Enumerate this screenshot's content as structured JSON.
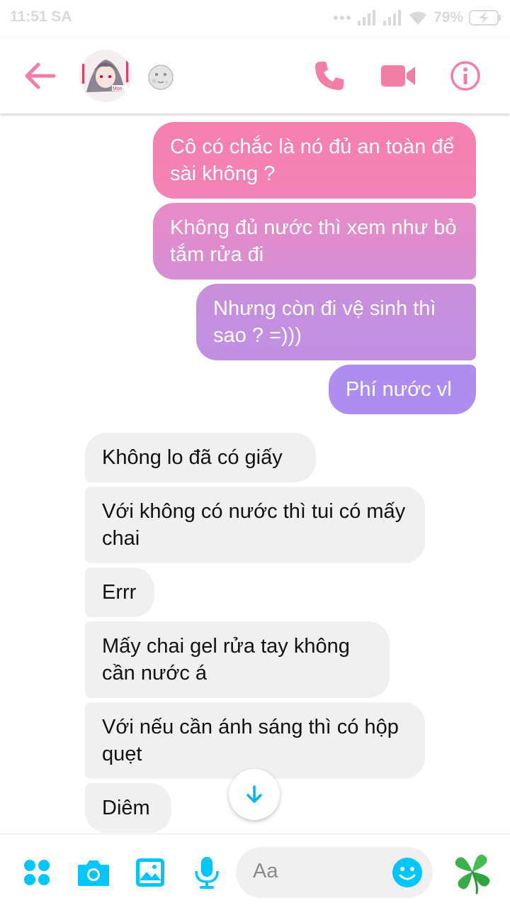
{
  "status_bar": {
    "time": "11:51 SA",
    "battery": "79%"
  },
  "header": {
    "back_icon": "arrow-left-icon",
    "avatar_icon": "avatar",
    "status_icon": "moon-emoji-icon",
    "call_icon": "phone-icon",
    "video_icon": "video-camera-icon",
    "info_icon": "info-icon",
    "accent": "#f27ea6"
  },
  "messages": [
    {
      "from": "me",
      "text": "Cô có chắc là nó đủ an toàn để sài không ?"
    },
    {
      "from": "me",
      "text": "Không đủ nước thì xem như bỏ tắm rửa đi"
    },
    {
      "from": "me",
      "text": "Nhưng còn đi vệ sinh thì sao ? =)))"
    },
    {
      "from": "me",
      "text": "Phí nước vl"
    },
    {
      "from": "them",
      "text": "Không lo đã có giấy"
    },
    {
      "from": "them",
      "text": "Với không có nước thì tui có mấy chai"
    },
    {
      "from": "them",
      "text": "Errr"
    },
    {
      "from": "them",
      "text": "Mấy chai gel rửa tay không cần nước á"
    },
    {
      "from": "them",
      "text": "Với nếu cần ánh sáng thì có hộp quẹt"
    },
    {
      "from": "them",
      "text": "Diêm"
    }
  ],
  "composer": {
    "placeholder": "Aa",
    "icons": [
      "apps-icon",
      "camera-icon",
      "gallery-icon",
      "microphone-icon",
      "emoji-icon",
      "clover-icon"
    ],
    "accent": "#00c6ff"
  },
  "colors": {
    "out_top": "#f67fae",
    "out_bottom": "#ad8ef0",
    "in_bg": "#f1f0f0"
  }
}
